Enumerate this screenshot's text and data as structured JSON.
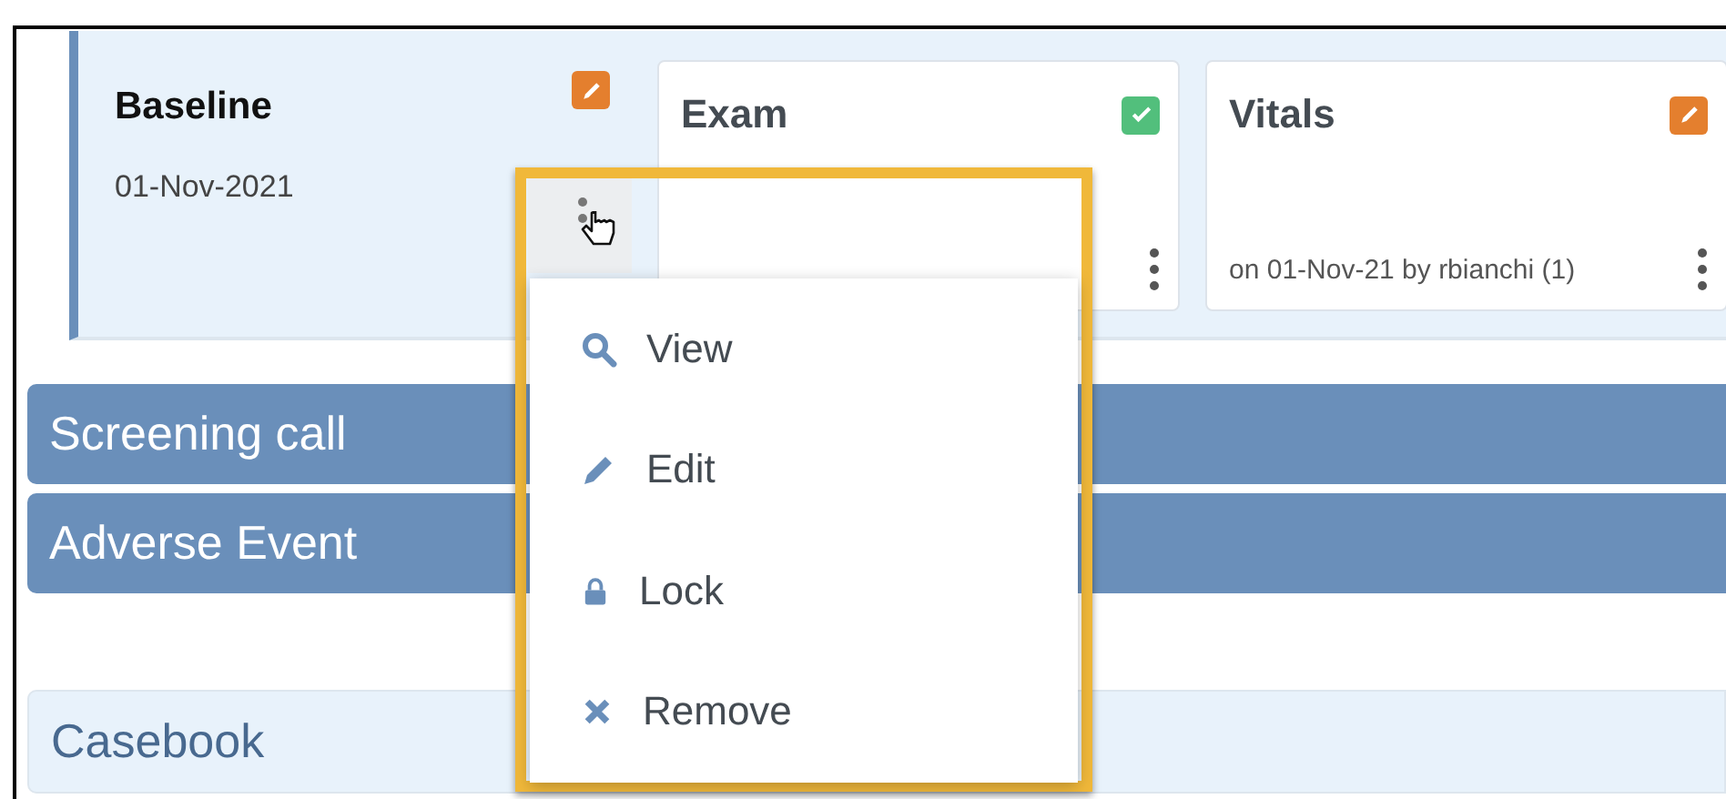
{
  "visit": {
    "title": "Baseline",
    "date": "01-Nov-2021",
    "complete": false
  },
  "forms": [
    {
      "title": "Exam",
      "complete": true
    },
    {
      "title": "Vitals",
      "complete": false,
      "footer": "on 01-Nov-21 by rbianchi (1)"
    }
  ],
  "event_bars": [
    {
      "label": "Screening call"
    },
    {
      "label": "Adverse Event"
    }
  ],
  "casebook": {
    "label": "Casebook"
  },
  "context_menu": {
    "items": [
      {
        "label": "View",
        "kind": "view"
      },
      {
        "label": "Edit",
        "kind": "edit"
      },
      {
        "label": "Lock",
        "kind": "lock"
      },
      {
        "label": "Remove",
        "kind": "remove"
      }
    ]
  }
}
